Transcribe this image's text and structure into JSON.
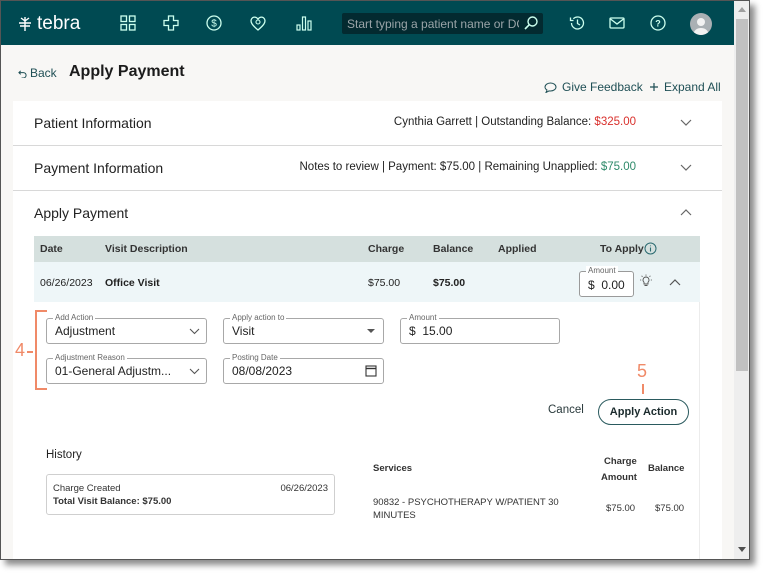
{
  "app": {
    "brand": "tebra",
    "nav_icons": [
      "dashboard-grid-icon",
      "clinical-cross-icon",
      "billing-dollar-icon",
      "patient-heart-icon",
      "reports-bar-chart-icon"
    ],
    "search": {
      "placeholder": "Start typing a patient name or DOB",
      "value": ""
    },
    "right_icons": [
      "history-clock-icon",
      "mail-icon",
      "help-icon",
      "user-avatar"
    ]
  },
  "header": {
    "back_label": "Back",
    "title": "Apply Payment",
    "give_feedback": "Give Feedback",
    "expand_all": "Expand All"
  },
  "sections": {
    "patient": {
      "title": "Patient Information",
      "summary_prefix": "Cynthia Garrett | Outstanding Balance: ",
      "summary_value": "$325.00",
      "expanded": false
    },
    "payment": {
      "title": "Payment Information",
      "summary_prefix": "Notes to review | Payment: $75.00 | Remaining Unapplied: ",
      "summary_value": "$75.00",
      "expanded": false
    },
    "apply": {
      "title": "Apply Payment",
      "expanded": true
    }
  },
  "table": {
    "columns": [
      "Date",
      "Visit Description",
      "Charge",
      "Balance",
      "Applied",
      "To Apply"
    ],
    "rows": [
      {
        "date": "06/26/2023",
        "description": "Office Visit",
        "charge": "$75.00",
        "balance": "$75.00",
        "applied": "",
        "amount_label": "Amount",
        "currency": "$",
        "to_apply": "0.00"
      }
    ]
  },
  "action_form": {
    "add_action": {
      "label": "Add Action",
      "value": "Adjustment"
    },
    "apply_to": {
      "label": "Apply action to",
      "value": "Visit"
    },
    "amount": {
      "label": "Amount",
      "currency": "$",
      "value": "15.00"
    },
    "adjustment_reason": {
      "label": "Adjustment Reason",
      "value": "01-General Adjustm..."
    },
    "posting_date": {
      "label": "Posting Date",
      "value": "08/08/2023"
    },
    "cancel_label": "Cancel",
    "apply_label": "Apply Action"
  },
  "annotations": {
    "step4": "4",
    "step5": "5"
  },
  "history": {
    "title": "History",
    "entry": {
      "event": "Charge Created",
      "date": "06/26/2023",
      "total": "Total Visit Balance: $75.00"
    }
  },
  "services": {
    "columns": {
      "service": "Services",
      "charge_amount_1": "Charge",
      "charge_amount_2": "Amount",
      "balance": "Balance"
    },
    "rows": [
      {
        "line1": "90832 - PSYCHOTHERAPY W/PATIENT 30",
        "line2": "MINUTES",
        "charge": "$75.00",
        "balance": "$75.00"
      }
    ]
  },
  "colors": {
    "brand": "#004a52",
    "negative": "#d9302c",
    "positive": "#2e8a6a",
    "annotation": "#f08a68"
  }
}
